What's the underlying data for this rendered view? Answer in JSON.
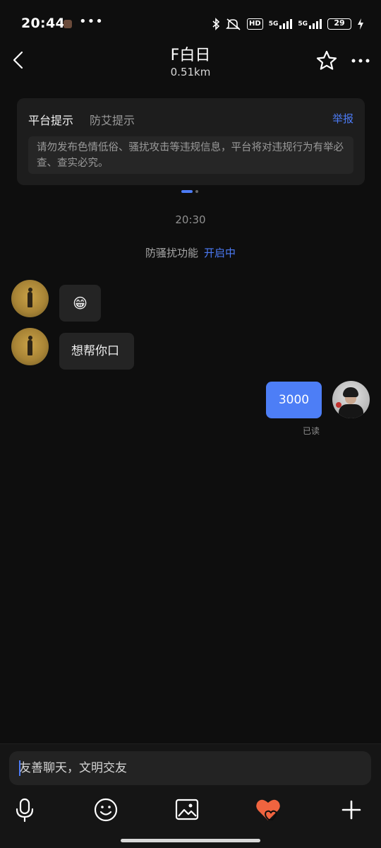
{
  "status_bar": {
    "time": "20:44",
    "dots": "•••",
    "hd": "HD",
    "sig1": "5G",
    "sig2": "5G",
    "battery": "29"
  },
  "header": {
    "title": "F白日",
    "distance": "0.51km"
  },
  "notice": {
    "tab_platform": "平台提示",
    "tab_aids": "防艾提示",
    "report": "举报",
    "body": "请勿发布色情低俗、骚扰攻击等违规信息，平台将对违规行为有举必查、查实必究。"
  },
  "chat": {
    "timestamp": "20:30",
    "anti_harass_text": "防骚扰功能",
    "anti_harass_state": "开启中",
    "messages": [
      {
        "from": "other",
        "text": "😁"
      },
      {
        "from": "other",
        "text": "想帮你口"
      },
      {
        "from": "self",
        "text": "3000"
      }
    ],
    "read_status": "已读"
  },
  "input": {
    "placeholder": "友善聊天，文明交友"
  },
  "toolbar": [
    "mic-icon",
    "emoji-icon",
    "image-icon",
    "heart-gift-icon",
    "plus-icon"
  ],
  "colors": {
    "background": "#0e0e0e",
    "accent": "#4c7bf5",
    "bubble_out": "#4d7ef6",
    "bubble_in": "#242424",
    "heart": "#f0643f"
  }
}
